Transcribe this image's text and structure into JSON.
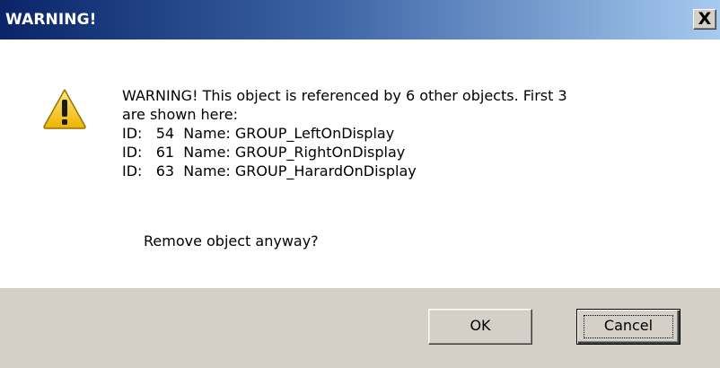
{
  "window": {
    "title": "WARNING!",
    "close_label": "X"
  },
  "icon": {
    "name": "warning-triangle-icon",
    "color": "#f5c518"
  },
  "message": {
    "lines": [
      "WARNING! This object is referenced by 6 other objects. First 3",
      "are shown here:",
      "ID:   54  Name: GROUP_LeftOnDisplay",
      "ID:   61  Name: GROUP_RightOnDisplay",
      "ID:   63  Name: GROUP_HarardOnDisplay"
    ],
    "question": "Remove object anyway?"
  },
  "buttons": {
    "ok_label": "OK",
    "cancel_label": "Cancel"
  },
  "colors": {
    "titlebar_start": "#0a246a",
    "titlebar_end": "#a6caf0",
    "footer_bg": "#d4d0c8"
  }
}
